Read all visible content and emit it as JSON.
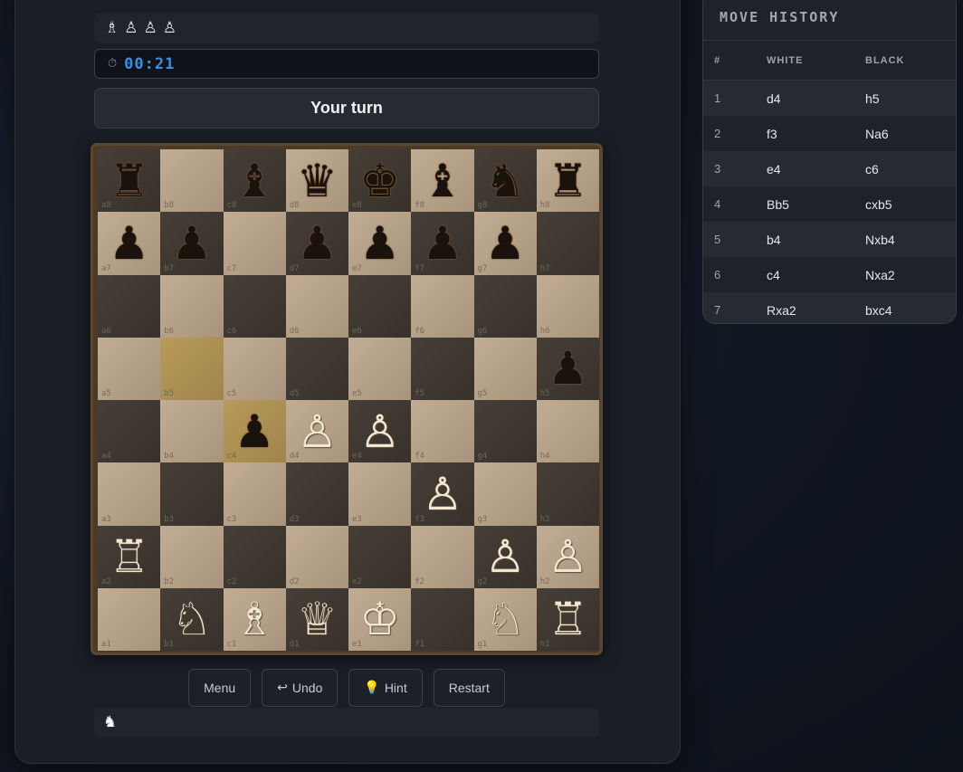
{
  "captured": {
    "pieces": [
      "♗",
      "♙",
      "♙",
      "♙"
    ]
  },
  "timer": {
    "icon": "stopwatch-icon",
    "glyph": "⏱",
    "time": "00:21"
  },
  "status": {
    "turn": "Your turn"
  },
  "board": {
    "highlight": [
      "b5",
      "c4"
    ],
    "pieces": {
      "a8": "bR",
      "c8": "bB",
      "d8": "bQ",
      "e8": "bK",
      "f8": "bB",
      "g8": "bN",
      "h8": "bR",
      "a7": "bP",
      "b7": "bP",
      "d7": "bP",
      "e7": "bP",
      "f7": "bP",
      "g7": "bP",
      "h5": "bP",
      "c4": "bP",
      "d4": "wP",
      "e4": "wP",
      "f3": "wP",
      "a2": "wR",
      "g2": "wP",
      "h2": "wP",
      "b1": "wN",
      "c1": "wB",
      "d1": "wQ",
      "e1": "wK",
      "g1": "wN",
      "h1": "wR"
    }
  },
  "controls": {
    "menu": "Menu",
    "undo": "Undo",
    "undo_icon": "↩",
    "hint": "Hint",
    "hint_icon": "💡",
    "restart": "Restart"
  },
  "footer": {
    "icon": "♞"
  },
  "history": {
    "title": "MOVE HISTORY",
    "columns": [
      "#",
      "WHITE",
      "BLACK"
    ],
    "moves": [
      [
        "1",
        "d4",
        "h5"
      ],
      [
        "2",
        "f3",
        "Na6"
      ],
      [
        "3",
        "e4",
        "c6"
      ],
      [
        "4",
        "Bb5",
        "cxb5"
      ],
      [
        "5",
        "b4",
        "Nxb4"
      ],
      [
        "6",
        "c4",
        "Nxa2"
      ],
      [
        "7",
        "Rxa2",
        "bxc4"
      ]
    ]
  }
}
